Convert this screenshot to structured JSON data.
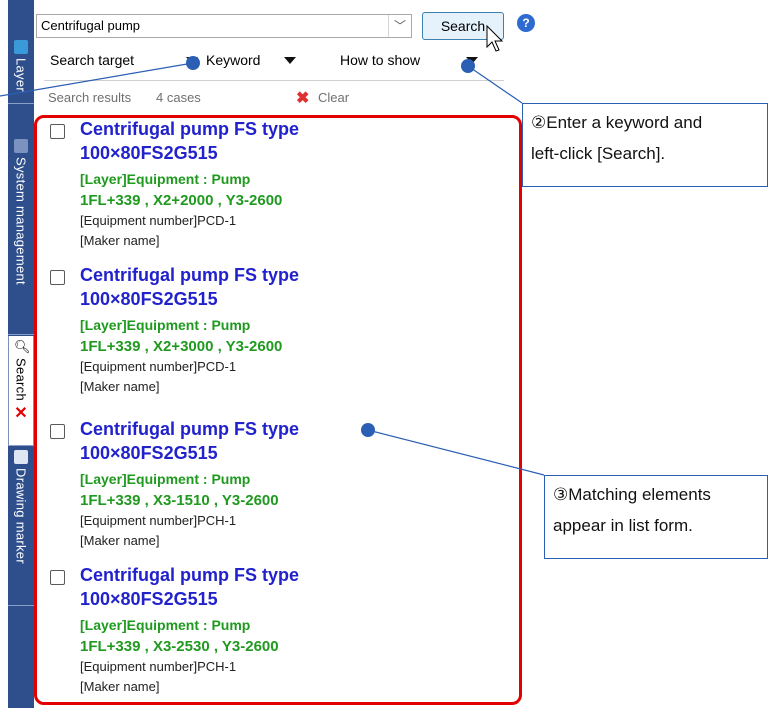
{
  "side_tabs": [
    {
      "label": "Layer"
    },
    {
      "label": "System management"
    },
    {
      "label": "Search"
    },
    {
      "label": "Drawing marker"
    }
  ],
  "search": {
    "value": "Centrifugal pump",
    "button_label": "Search"
  },
  "menu": {
    "search_target": "Search target",
    "keyword": "Keyword",
    "how_to_show": "How to show"
  },
  "results": {
    "label": "Search results",
    "count": "4 cases",
    "clear_label": "Clear"
  },
  "items": [
    {
      "title1": "Centrifugal pump FS type",
      "title2": "100×80FS2G515",
      "layer": "[Layer]Equipment : Pump",
      "coords": "1FL+339 , X2+2000 , Y3-2600",
      "equip": "[Equipment number]PCD-1",
      "maker": "[Maker name]"
    },
    {
      "title1": "Centrifugal pump FS type",
      "title2": "100×80FS2G515",
      "layer": "[Layer]Equipment : Pump",
      "coords": "1FL+339 , X2+3000 , Y3-2600",
      "equip": "[Equipment number]PCD-1",
      "maker": "[Maker name]"
    },
    {
      "title1": "Centrifugal pump FS type",
      "title2": "100×80FS2G515",
      "layer": "[Layer]Equipment : Pump",
      "coords": "1FL+339 , X3-1510 , Y3-2600",
      "equip": "[Equipment number]PCH-1",
      "maker": "[Maker name]"
    },
    {
      "title1": "Centrifugal pump FS type",
      "title2": "100×80FS2G515",
      "layer": "[Layer]Equipment : Pump",
      "coords": "1FL+339 , X3-2530 , Y3-2600",
      "equip": "[Equipment number]PCH-1",
      "maker": "[Maker name]"
    }
  ],
  "callouts": {
    "c2_line1": "②Enter a keyword and",
    "c2_line2": "left-click [Search].",
    "c3_line1": "③Matching elements",
    "c3_line2": "appear in list form."
  },
  "colors": {
    "title_blue": "#2222cc",
    "detail_green": "#1f9a1f",
    "frame_red": "#e30000",
    "tab_strip": "#2e4e8c",
    "callout_border": "#2b5fb4"
  }
}
